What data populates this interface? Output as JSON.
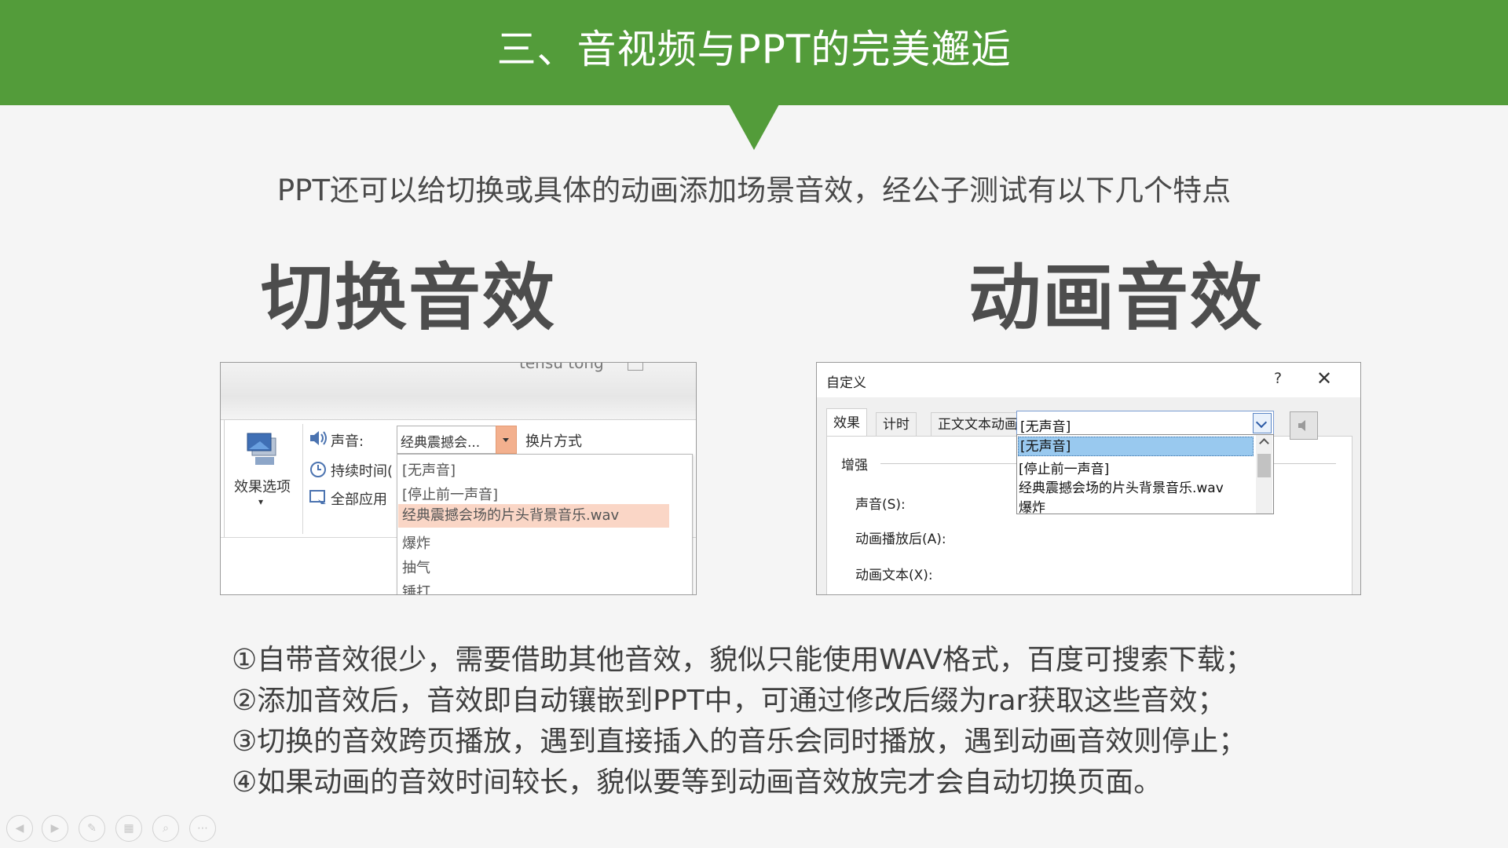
{
  "header": {
    "title": "三、音视频与PPT的完美邂逅"
  },
  "subtitle": "PPT还可以给切换或具体的动画添加场景音效，经公子测试有以下几个特点",
  "left": {
    "title": "切换音效",
    "ribbon_top_text": "tensu tong",
    "effect_options_label": "效果选项",
    "sound_label": "声音:",
    "sound_value": "经典震撼会...",
    "switch_mode_label": "换片方式",
    "duration_label": "持续时间(",
    "apply_all_label": "全部应用",
    "dropdown_items": [
      "[无声音]",
      "[停止前一声音]",
      "经典震撼会场的片头背景音乐.wav",
      "爆炸",
      "抽气",
      "锤打"
    ],
    "selected_index": 2
  },
  "right": {
    "title": "动画音效",
    "dialog_title": "自定义",
    "help": "?",
    "close": "✕",
    "tabs": [
      "效果",
      "计时",
      "正文文本动画"
    ],
    "active_tab": 0,
    "group_label": "增强",
    "sound_label": "声音(S):",
    "after_label": "动画播放后(A):",
    "text_label": "动画文本(X):",
    "sound_value": "[无声音]",
    "list_items": [
      "[无声音]",
      "[停止前一声音]",
      "经典震撼会场的片头背景音乐.wav",
      "爆炸"
    ],
    "selected_index": 0
  },
  "notes": [
    "①自带音效很少，需要借助其他音效，貌似只能使用WAV格式，百度可搜索下载；",
    "②添加音效后，音效即自动镶嵌到PPT中，可通过修改后缀为rar获取这些音效；",
    "③切换的音效跨页播放，遇到直接插入的音乐会同时播放，遇到动画音效则停止；",
    "④如果动画的音效时间较长，貌似要等到动画音效放完才会自动切换页面。"
  ],
  "toolbar_icons": [
    "previous-icon",
    "next-icon",
    "pen-icon",
    "slides-icon",
    "zoom-icon",
    "more-icon"
  ],
  "colors": {
    "header_green": "#539c3a",
    "dropdown_highlight": "#fad6c6",
    "list_highlight": "#99c9ef"
  }
}
